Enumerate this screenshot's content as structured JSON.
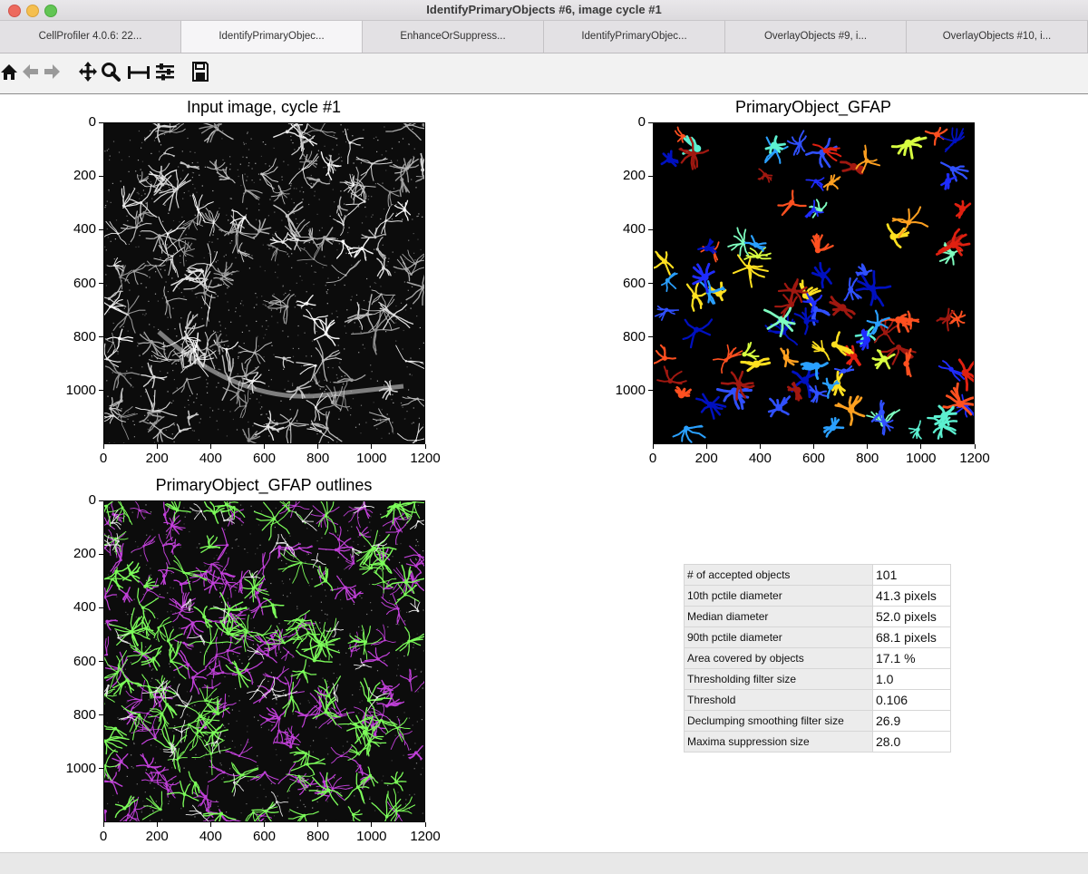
{
  "window": {
    "title": "IdentifyPrimaryObjects #6, image cycle #1"
  },
  "tabs": [
    {
      "label": "CellProfiler 4.0.6: 22...",
      "active": false
    },
    {
      "label": "IdentifyPrimaryObjec...",
      "active": true
    },
    {
      "label": "EnhanceOrSuppress...",
      "active": false
    },
    {
      "label": "IdentifyPrimaryObjec...",
      "active": false
    },
    {
      "label": "OverlayObjects #9, i...",
      "active": false
    },
    {
      "label": "OverlayObjects #10, i...",
      "active": false
    }
  ],
  "toolbar": {
    "icons": [
      "home-icon",
      "back-arrow-icon",
      "forward-arrow-icon",
      "pan-move-icon",
      "zoom-magnifier-icon",
      "axis-range-icon",
      "configure-subplots-icon",
      "save-figure-icon"
    ]
  },
  "plots": {
    "input": {
      "title": "Input image, cycle #1",
      "x_ticks": [
        "0",
        "200",
        "400",
        "600",
        "800",
        "1000",
        "1200"
      ],
      "y_ticks": [
        "0",
        "200",
        "400",
        "600",
        "800",
        "1000"
      ]
    },
    "objects": {
      "title": "PrimaryObject_GFAP",
      "x_ticks": [
        "0",
        "200",
        "400",
        "600",
        "800",
        "1000",
        "1200"
      ],
      "y_ticks": [
        "0",
        "200",
        "400",
        "600",
        "800",
        "1000"
      ]
    },
    "outlines": {
      "title": "PrimaryObject_GFAP outlines",
      "x_ticks": [
        "0",
        "200",
        "400",
        "600",
        "800",
        "1000",
        "1200"
      ],
      "y_ticks": [
        "0",
        "200",
        "400",
        "600",
        "800",
        "1000"
      ]
    }
  },
  "stats": {
    "rows": [
      {
        "label": "# of accepted objects",
        "value": "101"
      },
      {
        "label": "10th pctile diameter",
        "value": "41.3 pixels"
      },
      {
        "label": "Median diameter",
        "value": "52.0 pixels"
      },
      {
        "label": "90th pctile diameter",
        "value": "68.1 pixels"
      },
      {
        "label": "Area covered by objects",
        "value": "17.1 %"
      },
      {
        "label": "Thresholding filter size",
        "value": "1.0"
      },
      {
        "label": "Threshold",
        "value": "0.106"
      },
      {
        "label": "Declumping smoothing filter size",
        "value": "26.9"
      },
      {
        "label": "Maxima suppression size",
        "value": "28.0"
      }
    ]
  },
  "colors": {
    "outline_green": "#7cfc5a",
    "outline_magenta": "#c040d8",
    "label_palette": [
      "#1f2cff",
      "#3050ff",
      "#2aa0ff",
      "#5cf0d0",
      "#7fffc0",
      "#d8ff40",
      "#ffe020",
      "#ffa020",
      "#ff5020",
      "#e02010",
      "#a01810",
      "#0010c0"
    ]
  }
}
